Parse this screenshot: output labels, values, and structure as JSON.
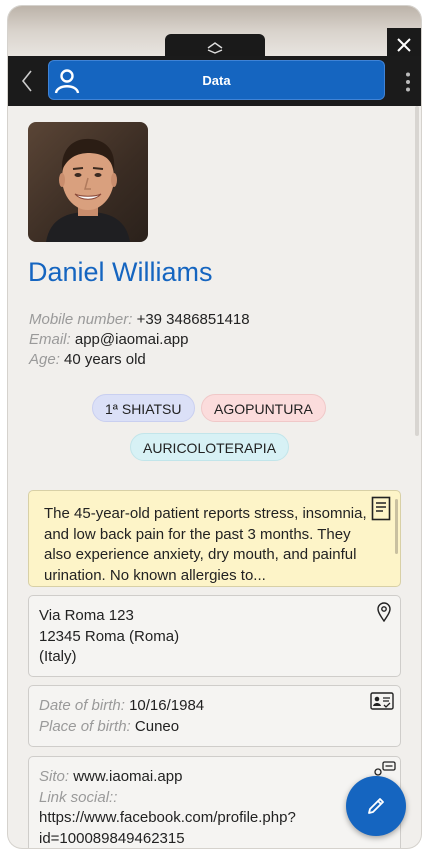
{
  "header": {
    "title": "Data"
  },
  "profile": {
    "name": "Daniel Williams",
    "mobile_label": "Mobile number:",
    "mobile": "+39 3486851418",
    "email_label": "Email:",
    "email": "app@iaomai.app",
    "age_label": "Age:",
    "age": "40 years old"
  },
  "tags": [
    {
      "label": "1ª SHIATSU",
      "color": "#dbe0f7"
    },
    {
      "label": "AGOPUNTURA",
      "color": "#fbdcdc"
    },
    {
      "label": "AURICOLOTERAPIA",
      "color": "#d7f1f5"
    }
  ],
  "note": {
    "text": "The 45-year-old patient reports stress, insomnia, and low back pain for the past 3 months. They also experience anxiety, dry mouth, and painful urination. No known allergies to..."
  },
  "address": {
    "line1": "Via Roma 123",
    "line2": "12345 Roma (Roma)",
    "line3": "(Italy)"
  },
  "birth": {
    "date_label": "Date of birth:",
    "date": "10/16/1984",
    "place_label": "Place of birth:",
    "place": "Cuneo"
  },
  "web": {
    "site_label": "Sito:",
    "site": "www.iaomai.app",
    "social_label": "Link social::",
    "social_line1": "https://www.facebook.com/profile.php?",
    "social_line2": "id=100089849462315"
  },
  "colors": {
    "accent": "#1565c0",
    "note_bg": "#fdf4c8",
    "bar": "#1b1b1b"
  },
  "icons": [
    "chevron-up-icon",
    "close-icon",
    "back-arrow-icon",
    "user-icon",
    "kebab-menu-icon",
    "note-icon",
    "location-pin-icon",
    "id-card-icon",
    "chat-icon",
    "pencil-icon"
  ]
}
